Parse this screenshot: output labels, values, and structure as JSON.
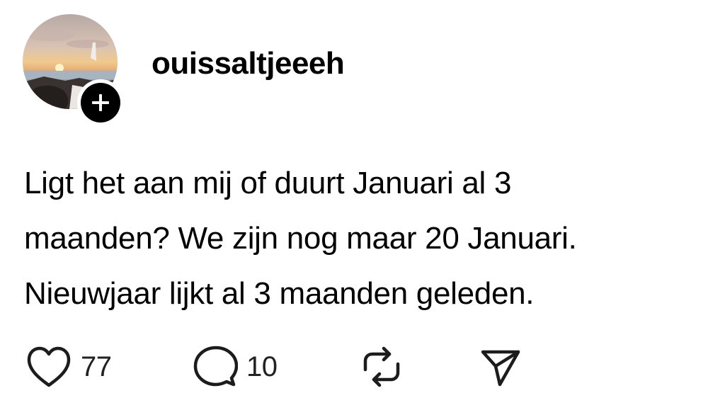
{
  "post": {
    "username": "ouissaltjeeeh",
    "text_lines": [
      "Ligt het aan mij of duurt Januari al 3",
      "maanden? We zijn nog maar 20 Januari.",
      "Nieuwjaar lijkt al 3 maanden geleden."
    ],
    "actions": {
      "like_count": "77",
      "reply_count": "10"
    }
  },
  "icons": {
    "avatar": "profile-photo",
    "follow": "plus-icon",
    "like": "heart-icon",
    "reply": "comment-bubble-icon",
    "repost": "repost-icon",
    "share": "send-icon"
  },
  "colors": {
    "text": "#000000",
    "count": "#222222",
    "badge": "#000000",
    "background": "#ffffff"
  }
}
